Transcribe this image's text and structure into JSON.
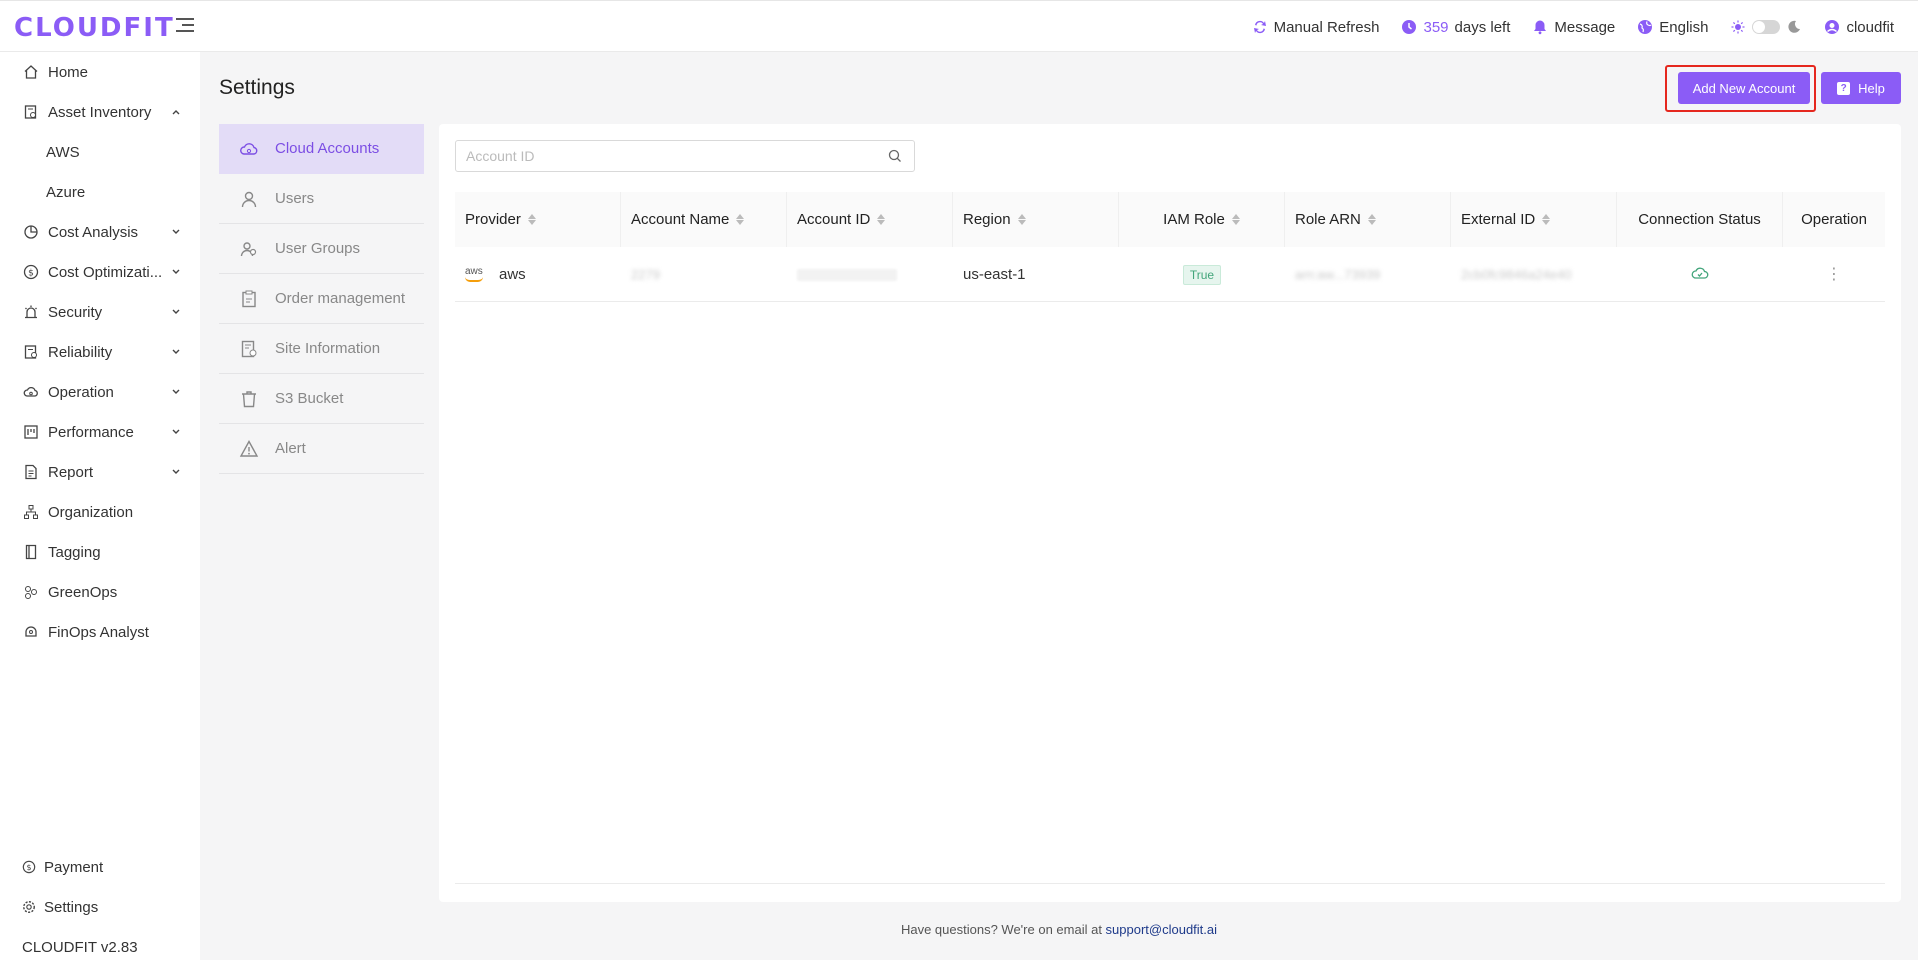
{
  "app": {
    "logo": "CLOUDFIT",
    "version": "CLOUDFIT v2.83"
  },
  "header": {
    "manual_refresh": "Manual Refresh",
    "days_count": "359",
    "days_label": "days left",
    "message": "Message",
    "language": "English",
    "user": "cloudfit"
  },
  "sidebar": {
    "items": [
      {
        "label": "Home",
        "icon": "home-icon"
      },
      {
        "label": "Asset Inventory",
        "icon": "inventory-icon",
        "expanded": true
      },
      {
        "label": "Cost Analysis",
        "icon": "cost-analysis-icon"
      },
      {
        "label": "Cost Optimizati...",
        "icon": "dollar-icon"
      },
      {
        "label": "Security",
        "icon": "alarm-icon"
      },
      {
        "label": "Reliability",
        "icon": "reliability-icon"
      },
      {
        "label": "Operation",
        "icon": "cloud-gear-icon"
      },
      {
        "label": "Performance",
        "icon": "performance-icon"
      },
      {
        "label": "Report",
        "icon": "report-icon"
      },
      {
        "label": "Organization",
        "icon": "organization-icon"
      },
      {
        "label": "Tagging",
        "icon": "tag-icon"
      },
      {
        "label": "GreenOps",
        "icon": "greenops-icon"
      },
      {
        "label": "FinOps Analyst",
        "icon": "finops-icon"
      }
    ],
    "asset_sub": [
      "AWS",
      "Azure"
    ],
    "payment": "Payment",
    "settings": "Settings"
  },
  "main": {
    "title": "Settings",
    "add_button": "Add New Account",
    "help_button": "Help"
  },
  "settings_menu": [
    {
      "label": "Cloud Accounts",
      "active": true
    },
    {
      "label": "Users"
    },
    {
      "label": "User Groups"
    },
    {
      "label": "Order management"
    },
    {
      "label": "Site Information"
    },
    {
      "label": "S3 Bucket"
    },
    {
      "label": "Alert"
    }
  ],
  "search": {
    "placeholder": "Account ID",
    "value": ""
  },
  "table": {
    "columns": [
      "Provider",
      "Account Name",
      "Account ID",
      "Region",
      "IAM Role",
      "Role ARN",
      "External ID",
      "Connection Status",
      "Operation"
    ],
    "rows": [
      {
        "provider": "aws",
        "account_name": "2279",
        "account_id": "",
        "region": "us-east-1",
        "iam_role": "True",
        "role_arn": "arn:aw...73939",
        "external_id": "2cb0fc9846a24e40"
      }
    ]
  },
  "footer": {
    "text": "Have questions? We're on email at ",
    "email": "support@cloudfit.ai"
  },
  "colors": {
    "accent": "#8b5cf6",
    "highlight": "#e5271e",
    "success": "#43a57b"
  }
}
